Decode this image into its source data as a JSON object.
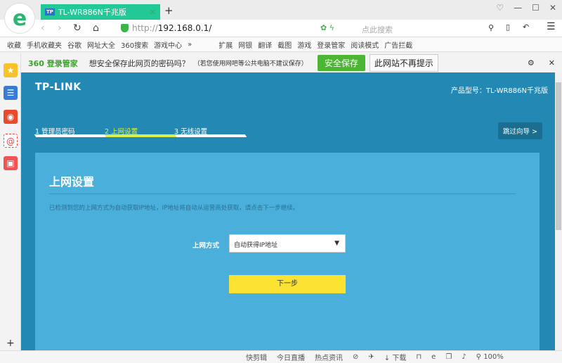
{
  "tab": {
    "favicon": "TP",
    "title": "TL-WR886N千兆版"
  },
  "address": {
    "url_prefix": "http://",
    "url_host": "192.168.0.1/",
    "search_placeholder": "点此搜索"
  },
  "bookmarks": [
    "收藏",
    "手机收藏夹",
    "谷歌",
    "网址大全",
    "360搜索",
    "游戏中心",
    "»",
    "扩展",
    "网银",
    "翻译",
    "截图",
    "游戏",
    "登录管家",
    "阅读模式",
    "广告拦截"
  ],
  "password_bar": {
    "brand": "360 登录管家",
    "question": "想安全保存此网页的密码吗？",
    "note": "（若您使用网吧等公共电脑不建议保存）",
    "save": "安全保存",
    "never": "此网站不再提示"
  },
  "page": {
    "logo": "TP-LINK",
    "model": "产品型号：TL-WR886N千兆版",
    "steps": [
      {
        "label": "1 管理员密码",
        "active": false
      },
      {
        "label": "2 上网设置",
        "active": true
      },
      {
        "label": "3 无线设置",
        "active": false
      }
    ],
    "skip": "跳过向导 >",
    "title": "上网设置",
    "description": "已检测到您的上网方式为自动获取IP地址，IP地址将自动从运营商处获取，请点击下一步继续。",
    "mode_label": "上网方式",
    "mode_value": "自动获得IP地址",
    "next": "下一步"
  },
  "status": {
    "items": [
      "快剪辑",
      "今日直播",
      "热点资讯",
      "下载"
    ],
    "zoom": "100%"
  },
  "colors": {
    "page_bg": "#2389b4",
    "panel_bg": "#4aafda",
    "active_step": "#d4f04a",
    "next_button": "#fbe232",
    "tab": "#22c896"
  }
}
